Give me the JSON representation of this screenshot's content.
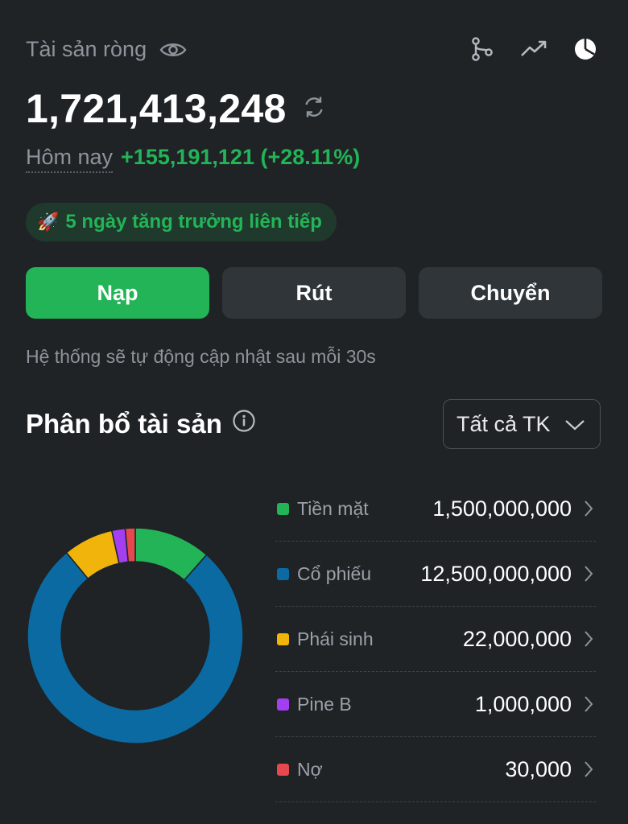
{
  "header": {
    "net_worth_label": "Tài sản ròng",
    "net_worth_value": "1,721,413,248",
    "today_label": "Hôm nay",
    "today_change": "+155,191,121 (+28.11%)",
    "icons": [
      "eye-icon",
      "branch-icon",
      "trend-up-icon",
      "pie-chart-icon",
      "refresh-icon"
    ]
  },
  "streak": {
    "icon": "rocket-icon",
    "label": "5 ngày tăng trưởng liên tiếp"
  },
  "actions": {
    "deposit": "Nạp",
    "withdraw": "Rút",
    "transfer": "Chuyển"
  },
  "notice": "Hệ thống sẽ tự động cập nhật sau mỗi 30s",
  "allocation": {
    "title": "Phân bổ tài sản",
    "filter": "Tất cả TK",
    "items": [
      {
        "name": "Tiền mặt",
        "value": "1,500,000,000",
        "color": "#22b456"
      },
      {
        "name": "Cổ phiếu",
        "value": "12,500,000,000",
        "color": "#0b6aa2"
      },
      {
        "name": "Phái sinh",
        "value": "22,000,000",
        "color": "#f1b40b"
      },
      {
        "name": "Pine B",
        "value": "1,000,000",
        "color": "#a33ff0"
      },
      {
        "name": "Nợ",
        "value": "30,000",
        "color": "#e5484d"
      }
    ]
  },
  "chart_data": {
    "type": "pie",
    "categories": [
      "Tiền mặt",
      "Cổ phiếu",
      "Phái sinh",
      "Pine B",
      "Nợ"
    ],
    "values": [
      11.5,
      77.5,
      7.5,
      2,
      1.5
    ],
    "colors": [
      "#22b456",
      "#0b6aa2",
      "#f1b40b",
      "#a33ff0",
      "#e5484d"
    ],
    "donut": true
  },
  "colors": {
    "background": "#1f2326",
    "accent_green": "#22b456",
    "muted_text": "#8d949b"
  }
}
